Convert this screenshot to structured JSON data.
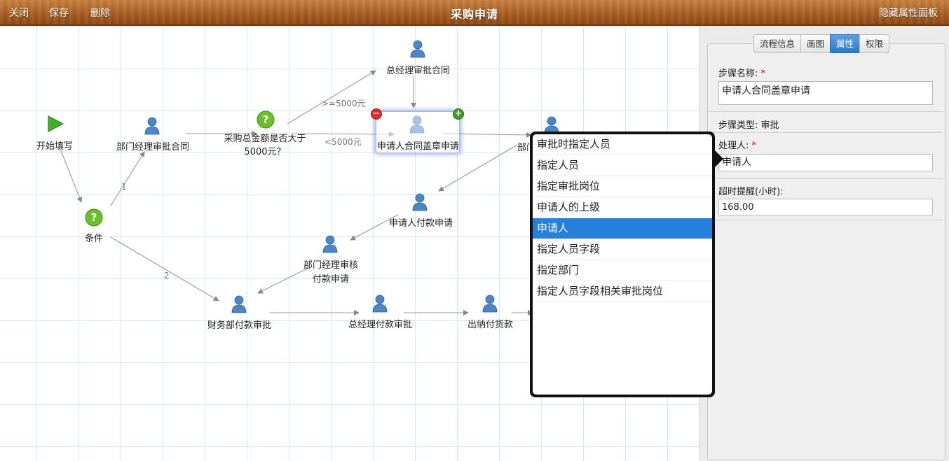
{
  "toolbar": {
    "close_label": "关闭",
    "save_label": "保存",
    "delete_label": "删除",
    "title": "采购申请",
    "hide_panel_label": "隐藏属性面板"
  },
  "canvas": {
    "nodes": {
      "start": "开始填写",
      "dept_mgr_approve": "部门经理审批合同",
      "amount_check": "采购总金额是否大于5000元？",
      "gm_approve": "总经理审批合同",
      "seal": "申请人合同盖章申请",
      "dept_partial": "部门",
      "condition": "条件",
      "pay_request": "申请人付款申请",
      "dept_review_1": "部门经理审核",
      "dept_review_2": "付款申请",
      "finance": "财务部付款审批",
      "gm_pay": "总经理付款审批",
      "cashier": "出纳付货款"
    },
    "edge_labels": {
      "gt5000": ">=5000元",
      "lt5000": "<5000元",
      "branch1": "1",
      "branch2": "2"
    }
  },
  "panel": {
    "tabs": [
      {
        "label": "流程信息",
        "active": false
      },
      {
        "label": "画图",
        "active": false
      },
      {
        "label": "属性",
        "active": true
      },
      {
        "label": "权限",
        "active": false
      }
    ],
    "step_name_label": "步骤名称:",
    "step_name_value": "申请人合同盖章申请",
    "step_type_label": "步骤类型: 审批",
    "handler_label": "处理人:",
    "handler_value": "申请人",
    "timeout_label": "超时提醒(小时):",
    "timeout_value": "168.00",
    "required_mark": "*"
  },
  "dropdown": {
    "options": [
      "审批时指定人员",
      "指定人员",
      "指定审批岗位",
      "申请人的上级",
      "申请人",
      "指定人员字段",
      "指定部门",
      "指定人员字段相关审批岗位"
    ],
    "selected": "申请人"
  },
  "colors": {
    "toolbar": "#a85d22",
    "tab_active": "#2f78c8",
    "option_selected": "#2680db",
    "grid": "#d6e6f2"
  }
}
